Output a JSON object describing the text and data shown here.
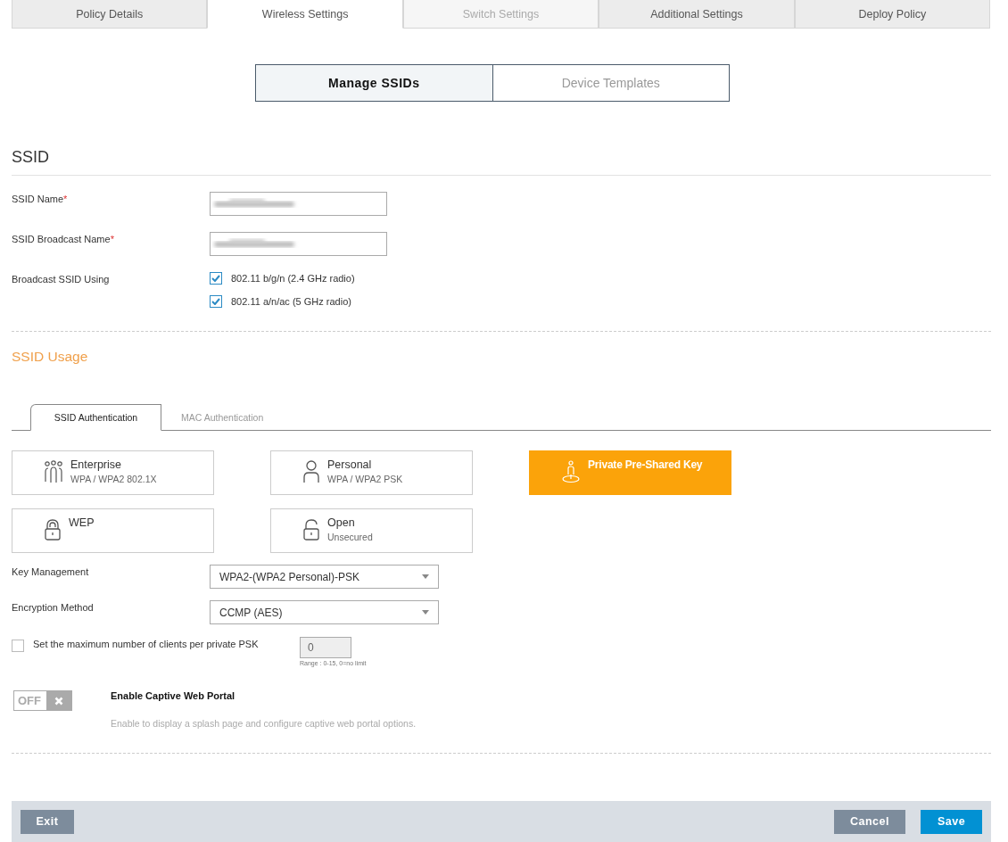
{
  "tabs": [
    {
      "label": "Policy Details",
      "selected": false,
      "disabled": false
    },
    {
      "label": "Wireless Settings",
      "selected": true,
      "disabled": false
    },
    {
      "label": "Switch Settings",
      "selected": false,
      "disabled": true
    },
    {
      "label": "Additional Settings",
      "selected": false,
      "disabled": false
    },
    {
      "label": "Deploy Policy",
      "selected": false,
      "disabled": false
    }
  ],
  "subtabs": [
    {
      "label": "Manage SSIDs",
      "selected": true
    },
    {
      "label": "Device Templates",
      "selected": false
    }
  ],
  "ssid": {
    "heading": "SSID",
    "fields": [
      {
        "label": "SSID Name",
        "required_mark": "*"
      },
      {
        "label": "SSID Broadcast Name",
        "required_mark": "*"
      }
    ],
    "broadcast_label": "Broadcast SSID Using",
    "radios": [
      {
        "label": "802.11 b/g/n (2.4 GHz radio)",
        "checked": true
      },
      {
        "label": "802.11 a/n/ac (5 GHz radio)",
        "checked": true
      }
    ]
  },
  "usage": {
    "heading": "SSID Usage",
    "tabs": [
      {
        "label": "SSID Authentication",
        "selected": true
      },
      {
        "label": "MAC Authentication",
        "selected": false
      }
    ],
    "cards": [
      {
        "kind": "enterprise",
        "title": "Enterprise",
        "subtitle": "WPA / WPA2 802.1X",
        "selected": false
      },
      {
        "kind": "personal",
        "title": "Personal",
        "subtitle": "WPA / WPA2 PSK",
        "selected": false
      },
      {
        "kind": "ppsk",
        "title": "Private Pre-Shared Key",
        "selected": true
      },
      {
        "kind": "wep",
        "title": "WEP",
        "selected": false
      },
      {
        "kind": "open",
        "title": "Open",
        "subtitle": "Unsecured",
        "selected": false
      }
    ],
    "key_management": {
      "label": "Key Management",
      "value": "WPA2-(WPA2 Personal)-PSK"
    },
    "encryption": {
      "label": "Encryption Method",
      "value": "CCMP (AES)"
    },
    "max_clients": {
      "label": "Set the maximum number of clients per private PSK",
      "checked": false,
      "value": "0",
      "hint": "Range : 0-15, 0=no limit"
    },
    "captive_portal": {
      "toggle_label": "OFF",
      "on": false,
      "title": "Enable Captive Web Portal",
      "description": "Enable to display a splash page and configure captive web portal options."
    }
  },
  "footer": {
    "exit": "Exit",
    "cancel": "Cancel",
    "save": "Save"
  }
}
